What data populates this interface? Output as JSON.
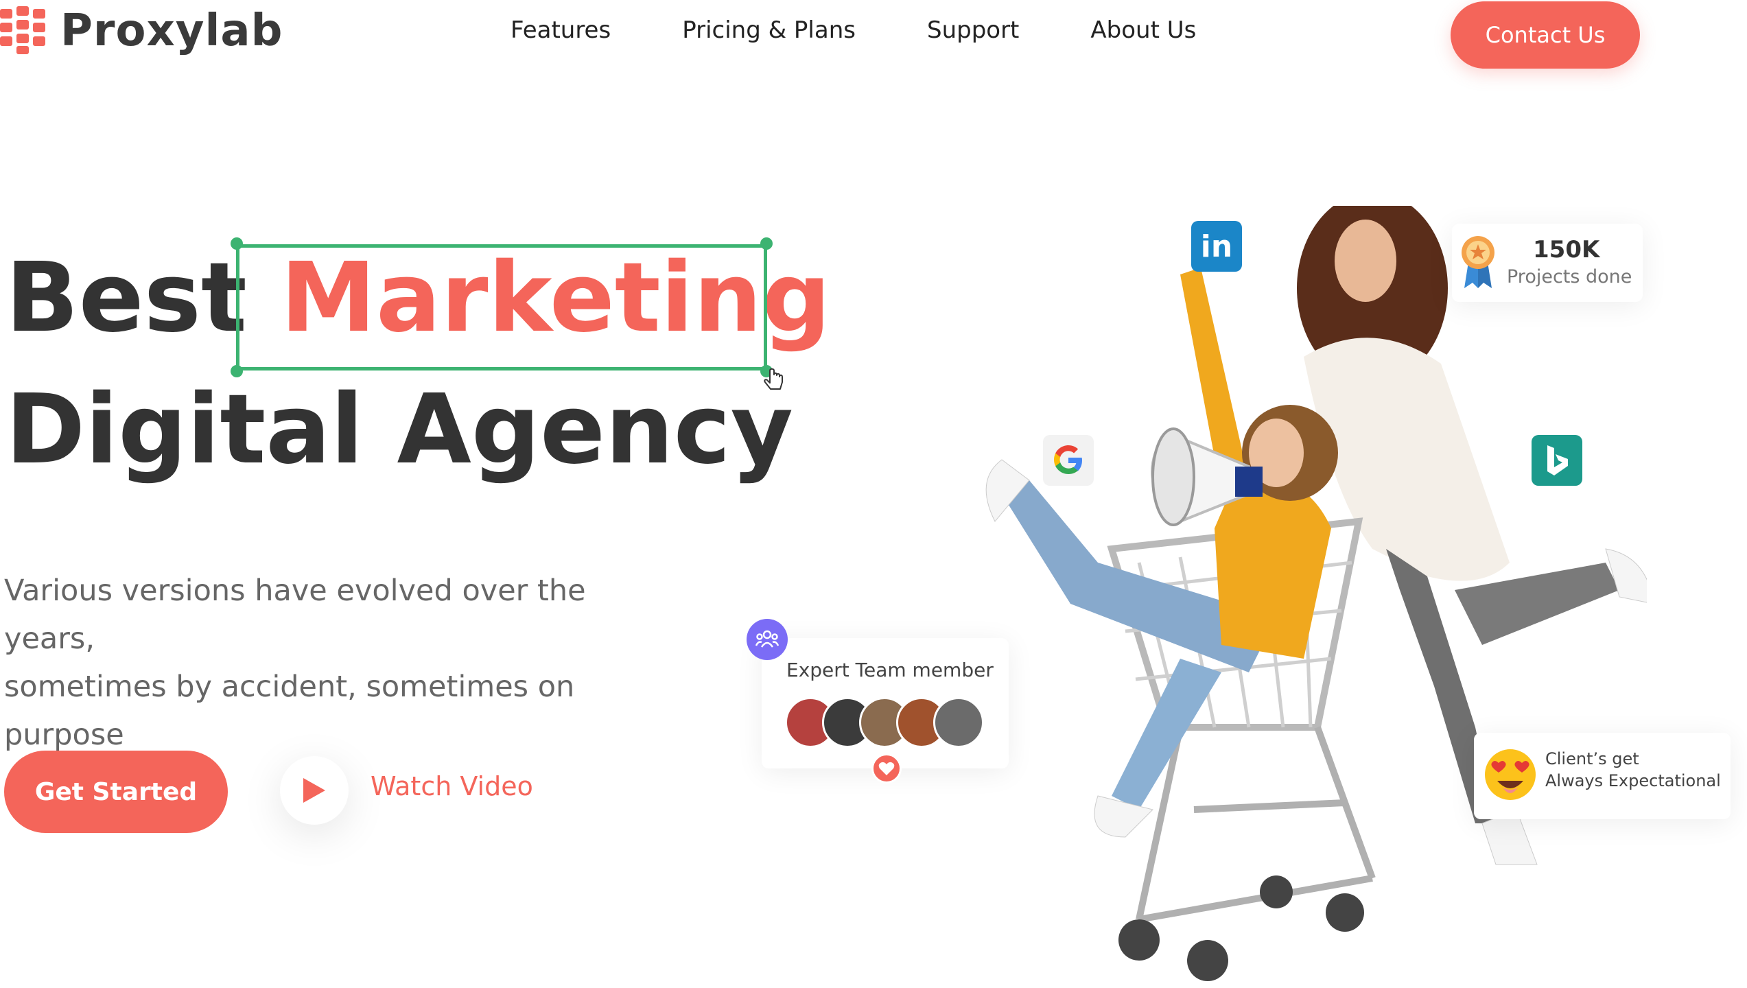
{
  "brand": {
    "name": "Proxylab",
    "accent": "#f4655a"
  },
  "nav": {
    "items": [
      {
        "label": "Features"
      },
      {
        "label": "Pricing & Plans"
      },
      {
        "label": "Support"
      },
      {
        "label": "About Us"
      }
    ],
    "contact_label": "Contact Us"
  },
  "hero": {
    "headline_word1": "Best",
    "headline_accent": "Marketing",
    "headline_line2": "Digital Agency",
    "subtitle_line1": "Various versions have evolved over the years,",
    "subtitle_line2": "sometimes by accident, sometimes on purpose",
    "cta_primary": "Get Started",
    "cta_secondary": "Watch Video"
  },
  "stats": {
    "projects_value": "150K",
    "projects_label": "Projects done"
  },
  "team_card": {
    "label": "Expert Team member",
    "avatar_colors": [
      "#b5413e",
      "#3b3b3b",
      "#8a6b4f",
      "#a0522d",
      "#6b6b6b"
    ]
  },
  "client_card": {
    "line1": "Client’s get",
    "line2": "Always Expectational"
  },
  "icons": {
    "linkedin": "linkedin-icon",
    "google": "google-icon",
    "bing": "bing-icon"
  }
}
